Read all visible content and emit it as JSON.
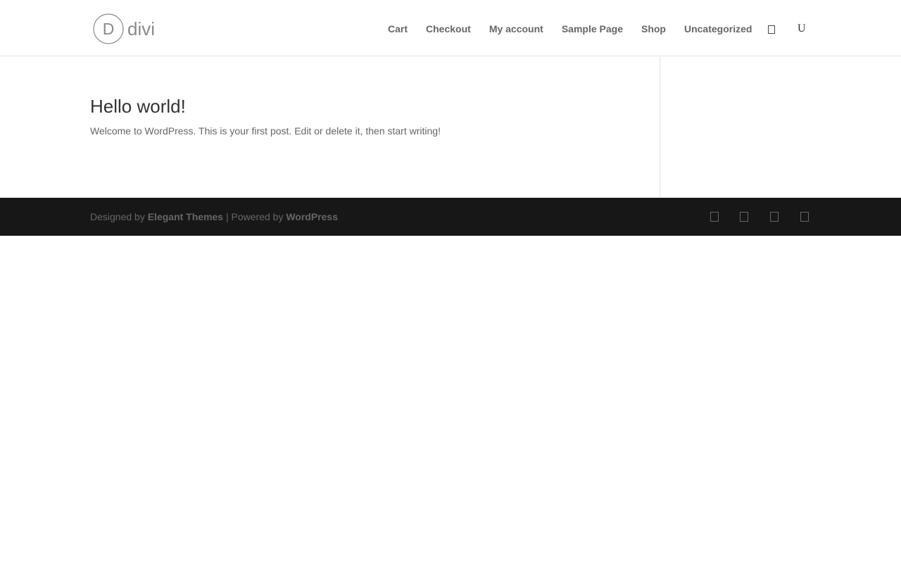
{
  "header": {
    "logo": {
      "text": "divi",
      "mark": "D",
      "icon": "divi-logo-icon"
    },
    "nav": [
      {
        "label": "Cart"
      },
      {
        "label": "Checkout"
      },
      {
        "label": "My account"
      },
      {
        "label": "Sample Page"
      },
      {
        "label": "Shop"
      },
      {
        "label": "Uncategorized"
      }
    ],
    "cart_icon": "cart-icon",
    "search_icon": {
      "glyph": "U",
      "name": "search-icon"
    }
  },
  "post": {
    "title": "Hello world!",
    "excerpt": "Welcome to WordPress. This is your first post. Edit or delete it, then start writing!"
  },
  "footer": {
    "designed_by_prefix": "Designed by ",
    "designer_link": "Elegant Themes",
    "separator": " | Powered by ",
    "powered_link": "WordPress",
    "social_icons": [
      "facebook-icon",
      "twitter-icon",
      "google-plus-icon",
      "rss-icon"
    ]
  },
  "colors": {
    "text": "#666666",
    "title": "#333333",
    "footer_bg": "#171717",
    "border": "#e2e2e2"
  }
}
